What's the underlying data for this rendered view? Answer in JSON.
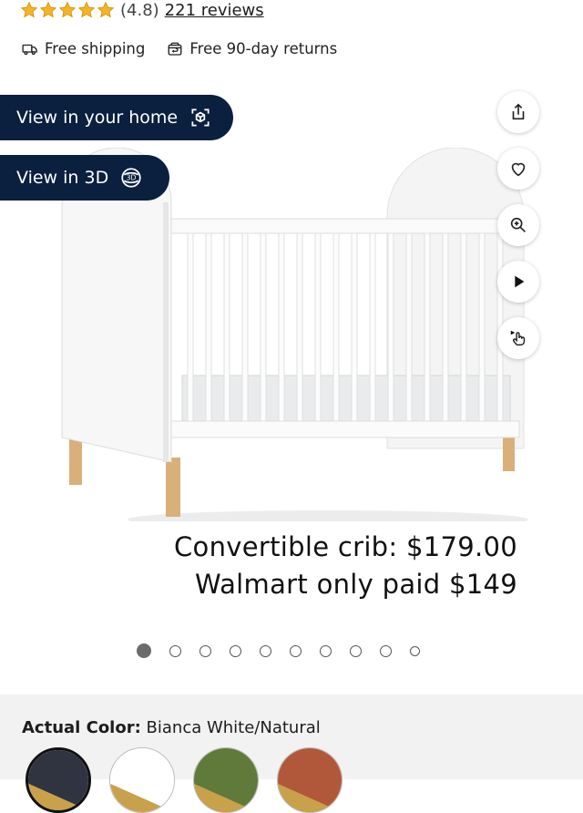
{
  "rating": {
    "value_text": "(4.8)",
    "reviews_text": "221 reviews",
    "stars": 5
  },
  "perks": {
    "shipping": "Free shipping",
    "returns": "Free 90-day returns"
  },
  "view_buttons": {
    "home": "View in your home",
    "threed": "View in 3D"
  },
  "side_actions": [
    "share-icon",
    "heart-icon",
    "zoom-in-icon",
    "play-icon",
    "touch-icon"
  ],
  "promo": {
    "line1": "Convertible crib: $179.00",
    "line2": "Walmart only paid $149"
  },
  "carousel": {
    "count": 10,
    "active_index": 0
  },
  "color": {
    "label": "Actual Color:",
    "value": "Bianca White/Natural"
  },
  "swatches": [
    {
      "name": "dark",
      "colors": [
        "#2f3440",
        "#c9a14a"
      ],
      "selected": true
    },
    {
      "name": "white",
      "colors": [
        "#ffffff",
        "#c9a14a"
      ],
      "selected": false
    },
    {
      "name": "green",
      "colors": [
        "#5f7a3a",
        "#c9a14a"
      ],
      "selected": false
    },
    {
      "name": "terracotta",
      "colors": [
        "#b2583a",
        "#c9a14a"
      ],
      "selected": false
    }
  ]
}
